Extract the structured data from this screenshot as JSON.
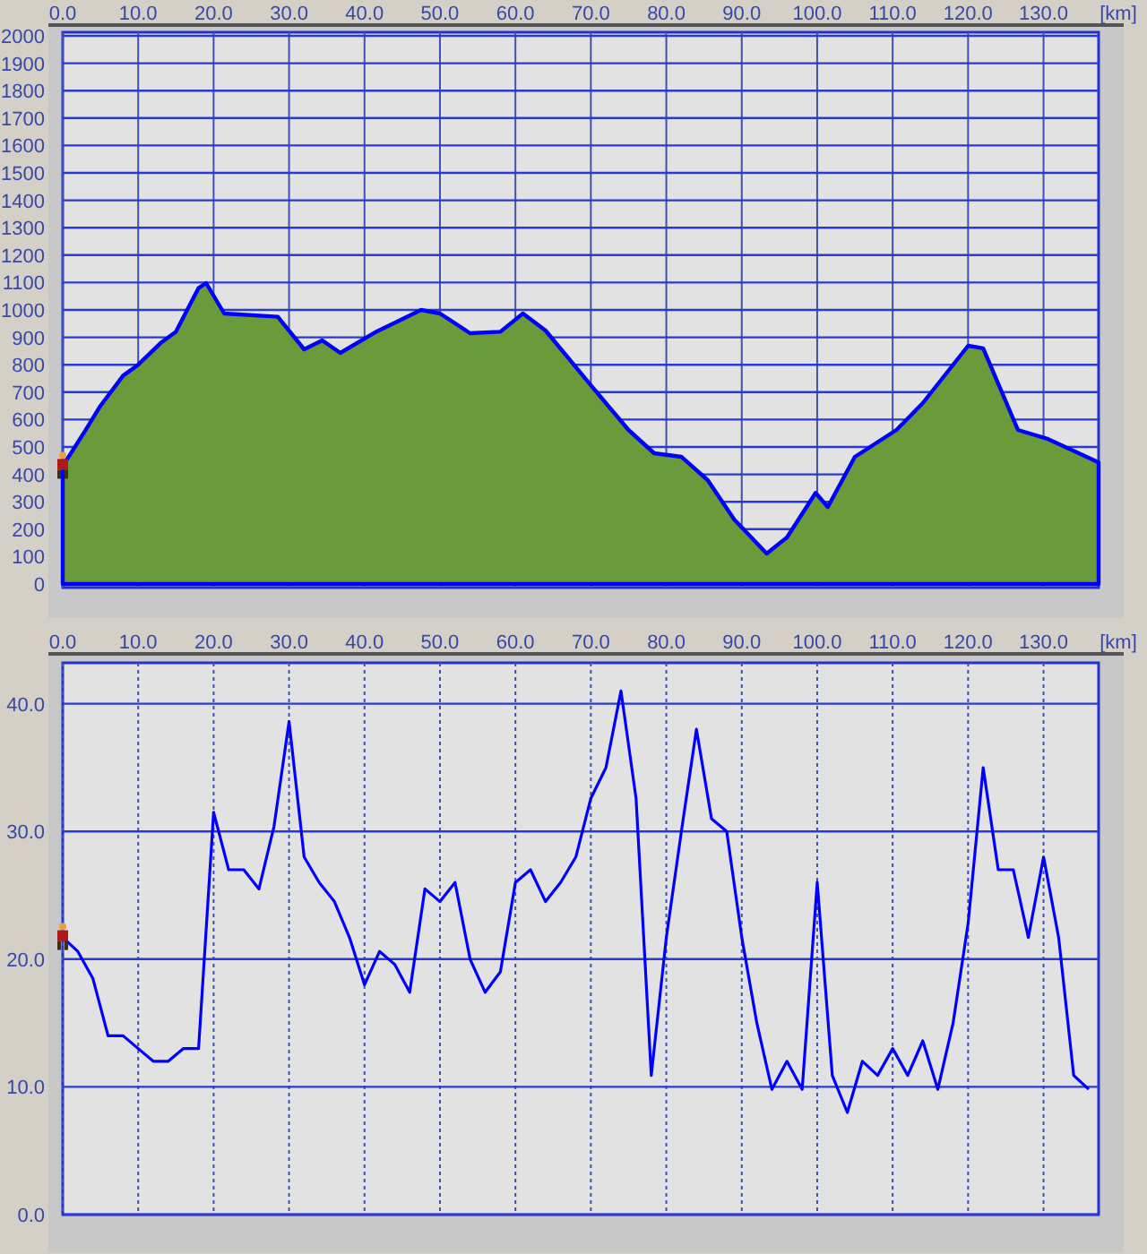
{
  "charts": [
    {
      "unit": "[km]",
      "chart_data": {
        "type": "area",
        "grid": true,
        "xlim": [
          0,
          137.3
        ],
        "ylim": [
          0,
          2000
        ],
        "xticks": [
          {
            "value": 0,
            "label": "0.0"
          },
          {
            "value": 10,
            "label": "10.0"
          },
          {
            "value": 20,
            "label": "20.0"
          },
          {
            "value": 30,
            "label": "30.0"
          },
          {
            "value": 40,
            "label": "40.0"
          },
          {
            "value": 50,
            "label": "50.0"
          },
          {
            "value": 60,
            "label": "60.0"
          },
          {
            "value": 70,
            "label": "70.0"
          },
          {
            "value": 80,
            "label": "80.0"
          },
          {
            "value": 90,
            "label": "90.0"
          },
          {
            "value": 100,
            "label": "100.0"
          },
          {
            "value": 110,
            "label": "110.0"
          },
          {
            "value": 120,
            "label": "120.0"
          },
          {
            "value": 130,
            "label": "130.0"
          }
        ],
        "yticks": [
          0,
          100,
          200,
          300,
          400,
          500,
          600,
          700,
          800,
          900,
          1000,
          1100,
          1200,
          1300,
          1400,
          1500,
          1600,
          1700,
          1800,
          1900,
          2000
        ],
        "x": [
          0,
          3,
          5,
          8,
          10,
          13,
          15,
          18,
          19,
          21.4,
          28.5,
          32,
          34.4,
          36.8,
          41.6,
          47.5,
          50,
          54,
          58,
          61,
          64,
          70,
          75,
          78.4,
          82,
          85.5,
          89,
          93.3,
          96,
          99.8,
          101.4,
          105,
          110.5,
          114,
          120,
          122,
          126.6,
          130.6,
          137.3
        ],
        "series": [
          {
            "color": "#0000ff",
            "values": [
              430,
              560,
              650,
              760,
              800,
              880,
              920,
              1080,
              1098,
              987,
              975,
              856,
              889,
              843,
              921,
              1000,
              987,
              915,
              920,
              987,
              925,
              725,
              562,
              477,
              464,
              379,
              235,
              111,
              170,
              333,
              281,
              464,
              562,
              660,
              869,
              860,
              562,
              529,
              444
            ]
          }
        ]
      }
    },
    {
      "unit": "[km]",
      "chart_data": {
        "type": "line",
        "grid": true,
        "xlim": [
          0,
          137.3
        ],
        "ylim": [
          0,
          43.2
        ],
        "xticks": [
          {
            "value": 0,
            "label": "0.0"
          },
          {
            "value": 10,
            "label": "10.0"
          },
          {
            "value": 20,
            "label": "20.0"
          },
          {
            "value": 30,
            "label": "30.0"
          },
          {
            "value": 40,
            "label": "40.0"
          },
          {
            "value": 50,
            "label": "50.0"
          },
          {
            "value": 60,
            "label": "60.0"
          },
          {
            "value": 70,
            "label": "70.0"
          },
          {
            "value": 80,
            "label": "80.0"
          },
          {
            "value": 90,
            "label": "90.0"
          },
          {
            "value": 100,
            "label": "100.0"
          },
          {
            "value": 110,
            "label": "110.0"
          },
          {
            "value": 120,
            "label": "120.0"
          },
          {
            "value": 130,
            "label": "130.0"
          }
        ],
        "yticks": [
          {
            "value": 0,
            "label": "0.0"
          },
          {
            "value": 10,
            "label": "10.0"
          },
          {
            "value": 20,
            "label": "20.0"
          },
          {
            "value": 30,
            "label": "30.0"
          },
          {
            "value": 40,
            "label": "40.0"
          }
        ],
        "x": [
          0,
          2,
          4,
          6,
          8,
          10,
          12,
          14,
          16,
          18,
          20,
          22,
          24,
          26,
          28,
          30,
          32,
          34,
          36,
          38,
          40,
          42,
          44,
          46,
          48,
          50,
          52,
          54,
          56,
          58,
          60,
          62,
          64,
          66,
          68,
          70,
          72,
          74,
          76,
          78,
          80,
          82,
          84,
          86,
          88,
          90,
          92,
          94,
          96,
          98,
          100,
          102,
          104,
          106,
          108,
          110,
          112,
          114,
          116,
          118,
          120,
          122,
          124,
          126,
          128,
          130,
          132,
          134,
          136
        ],
        "series": [
          {
            "color": "#0000ff",
            "values": [
              21.7,
              20.6,
              18.5,
              14,
              14,
              13,
              12,
              12,
              13,
              13,
              31.5,
              27,
              27,
              25.5,
              30.4,
              38.6,
              28,
              26,
              24.5,
              21.7,
              18,
              20.6,
              19.6,
              17.4,
              25.5,
              24.5,
              26,
              20,
              17.4,
              19,
              26,
              27,
              24.5,
              26,
              28,
              32.6,
              35,
              41,
              32.6,
              10.9,
              21.7,
              30,
              38,
              31,
              30,
              21.7,
              15,
              9.8,
              12,
              9.8,
              26,
              10.9,
              8,
              12,
              10.9,
              13,
              10.9,
              13.6,
              9.8,
              15,
              22.8,
              35,
              27,
              27,
              21.7,
              28,
              21.7,
              10.9,
              9.8
            ]
          }
        ]
      }
    }
  ]
}
